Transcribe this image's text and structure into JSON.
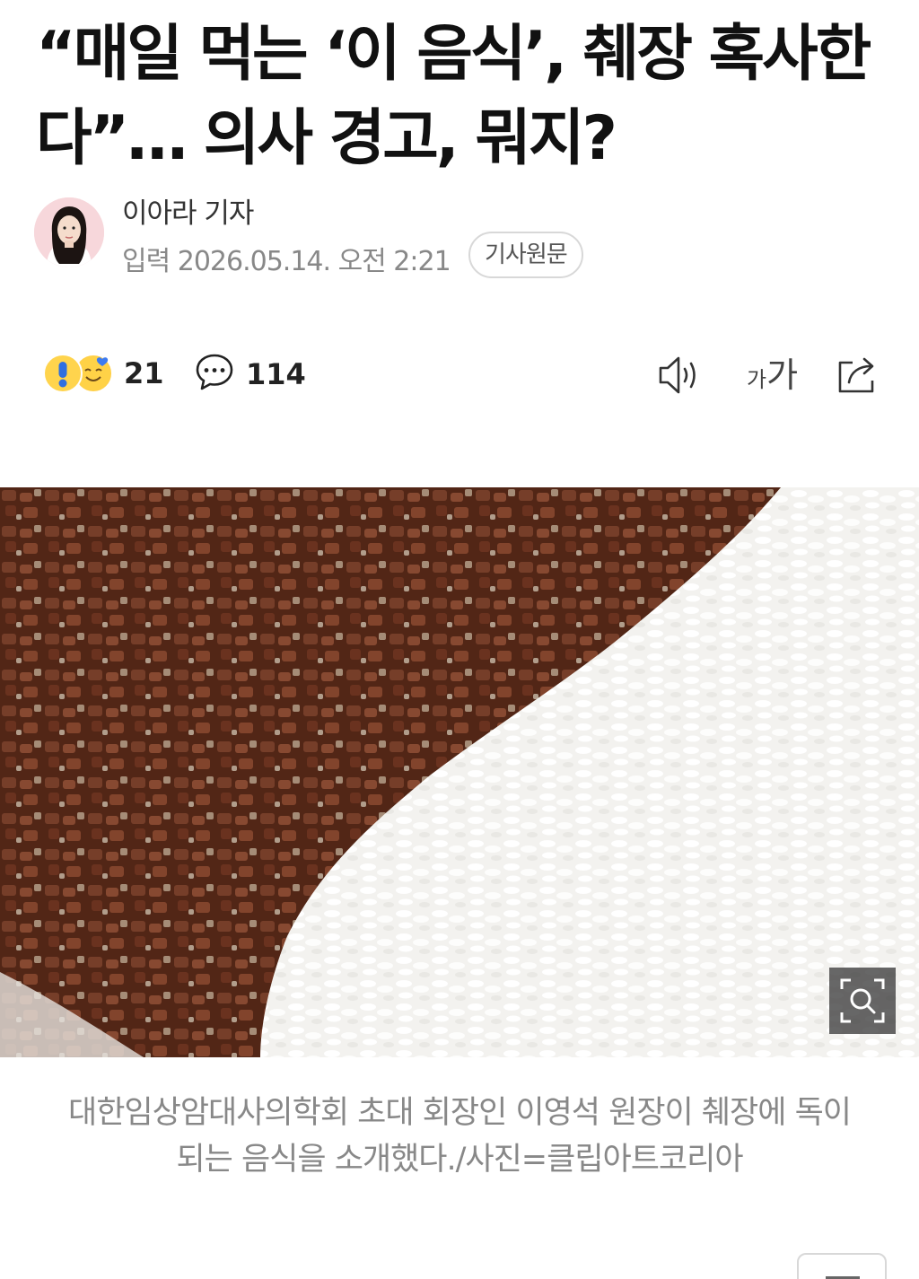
{
  "article": {
    "title_line1": "“매일 먹는 ‘이 음식’, 췌장 혹사한",
    "title_line2": "다”… 의사 경고, 뭐지?",
    "reporter": "이아라 기자",
    "published": "입력 2026.05.14. 오전 2:21",
    "original_link_label": "기사원문"
  },
  "actions": {
    "reaction_count": "21",
    "comment_count": "114",
    "font_size_small": "가",
    "font_size_large": "가",
    "icons": [
      "exclamation-emoji-icon",
      "smile-heart-emoji-icon",
      "comment-bubble-icon",
      "speaker-icon",
      "share-icon"
    ]
  },
  "photo": {
    "caption_line1": "대한임상암대사의학회 초대 회장인 이영석 원장이 췌장에 독이",
    "caption_line2": "되는 음식을 소개했다./사진=클립아트코리아",
    "zoom_icon": "zoom-search-icon"
  },
  "colors": {
    "text_primary": "#111111",
    "text_secondary": "#888888",
    "border": "#d8d8d8",
    "emoji_yellow": "#ffd44d"
  }
}
